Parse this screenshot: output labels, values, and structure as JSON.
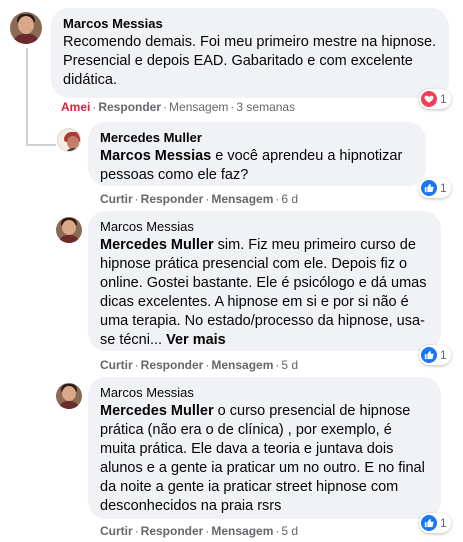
{
  "comments": [
    {
      "author": "Marcos Messias",
      "text": "Recomendo demais. Foi meu primeiro mestre na hipnose. Presencial e depois EAD. Gabaritado e com excelente didática.",
      "actions": {
        "react": "Amei",
        "reply": "Responder",
        "message": "Mensagem",
        "time": "3 semanas"
      },
      "reaction": {
        "icon": "heart-icon",
        "count": "1",
        "color": "#f33e58"
      }
    },
    {
      "author": "Mercedes Muller",
      "mention": "Marcos Messias",
      "text": " e você aprendeu a hipnotizar pessoas como ele faz?",
      "actions": {
        "react": "Curtir",
        "reply": "Responder",
        "message": "Mensagem",
        "time": "6 d"
      },
      "reaction": {
        "icon": "like-icon",
        "count": "1",
        "color": "#1877f2"
      }
    },
    {
      "author": "Marcos Messias",
      "mention": "Mercedes Muller",
      "text": " sim. Fiz meu primeiro curso de hipnose prática presencial com ele. Depois fiz o online. Gostei bastante. Ele é psicólogo e dá umas dicas excelentes. A hipnose em si e por si não é uma terapia. No estado/processo da hipnose, usa-se técni... ",
      "see_more": "Ver mais",
      "actions": {
        "react": "Curtir",
        "reply": "Responder",
        "message": "Mensagem",
        "time": "5 d"
      },
      "reaction": {
        "icon": "like-icon",
        "count": "1",
        "color": "#1877f2"
      }
    },
    {
      "author": "Marcos Messias",
      "mention": "Mercedes Muller",
      "text": " o curso presencial de hipnose prática (não era o de clínica) , por exemplo, é muita prática. Ele dava a teoria e juntava dois alunos e a gente ia praticar um no outro. E no final da noite a gente ia praticar street hipnose com desconhecidos na praia rsrs",
      "actions": {
        "react": "Curtir",
        "reply": "Responder",
        "message": "Mensagem",
        "time": "5 d"
      },
      "reaction": {
        "icon": "like-icon",
        "count": "1",
        "color": "#1877f2"
      }
    }
  ]
}
